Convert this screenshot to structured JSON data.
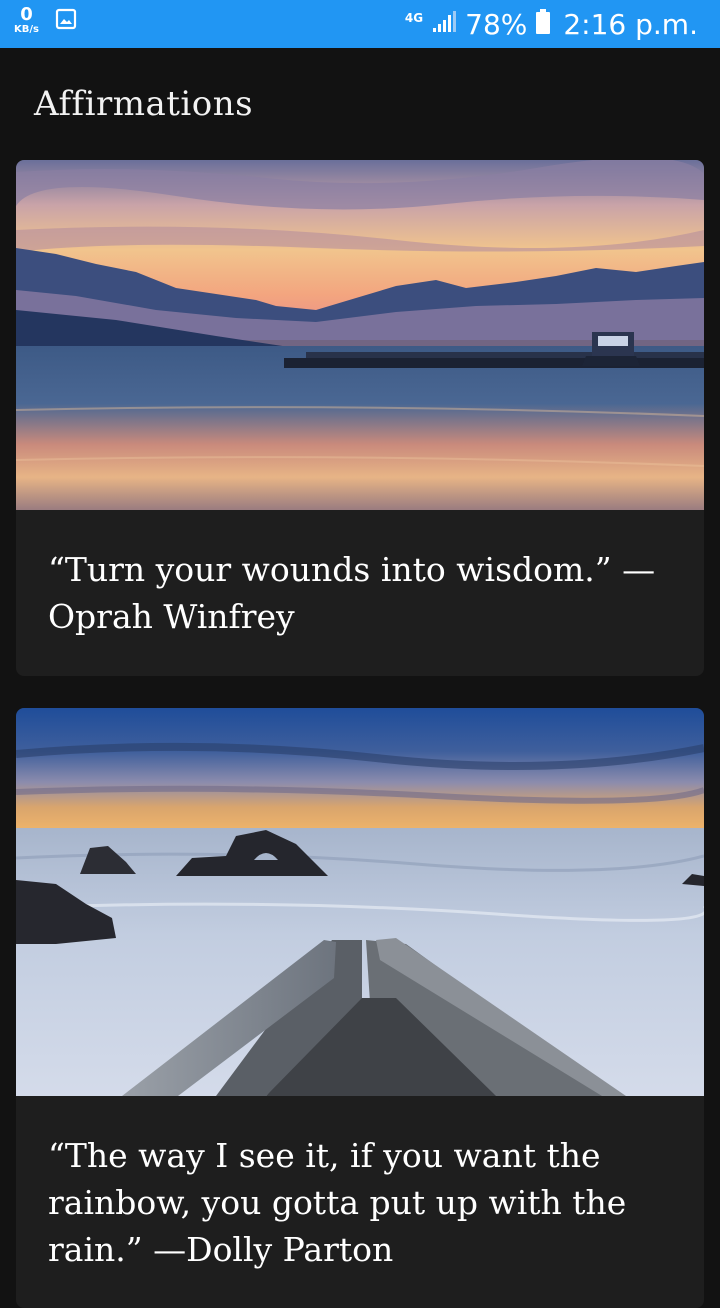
{
  "status_bar": {
    "speed_value": "0",
    "speed_unit": "KB/s",
    "network": "4G",
    "battery": "78%",
    "time": "2:16 p.m.",
    "icons": [
      "image-icon",
      "signal-icon",
      "battery-icon"
    ]
  },
  "app_bar": {
    "title": "Affirmations"
  },
  "colors": {
    "status_bar": "#2196f3",
    "background": "#121212",
    "card": "#1e1e1e",
    "text": "#ffffff"
  },
  "cards": [
    {
      "image": "lake-sunset-mountains",
      "quote": "“Turn your wounds into wisdom.” — Oprah Winfrey"
    },
    {
      "image": "sea-rocks-pier-sunset",
      "quote": "“The way I see it, if you want the rainbow, you gotta put up with the rain.” —Dolly Parton"
    }
  ]
}
